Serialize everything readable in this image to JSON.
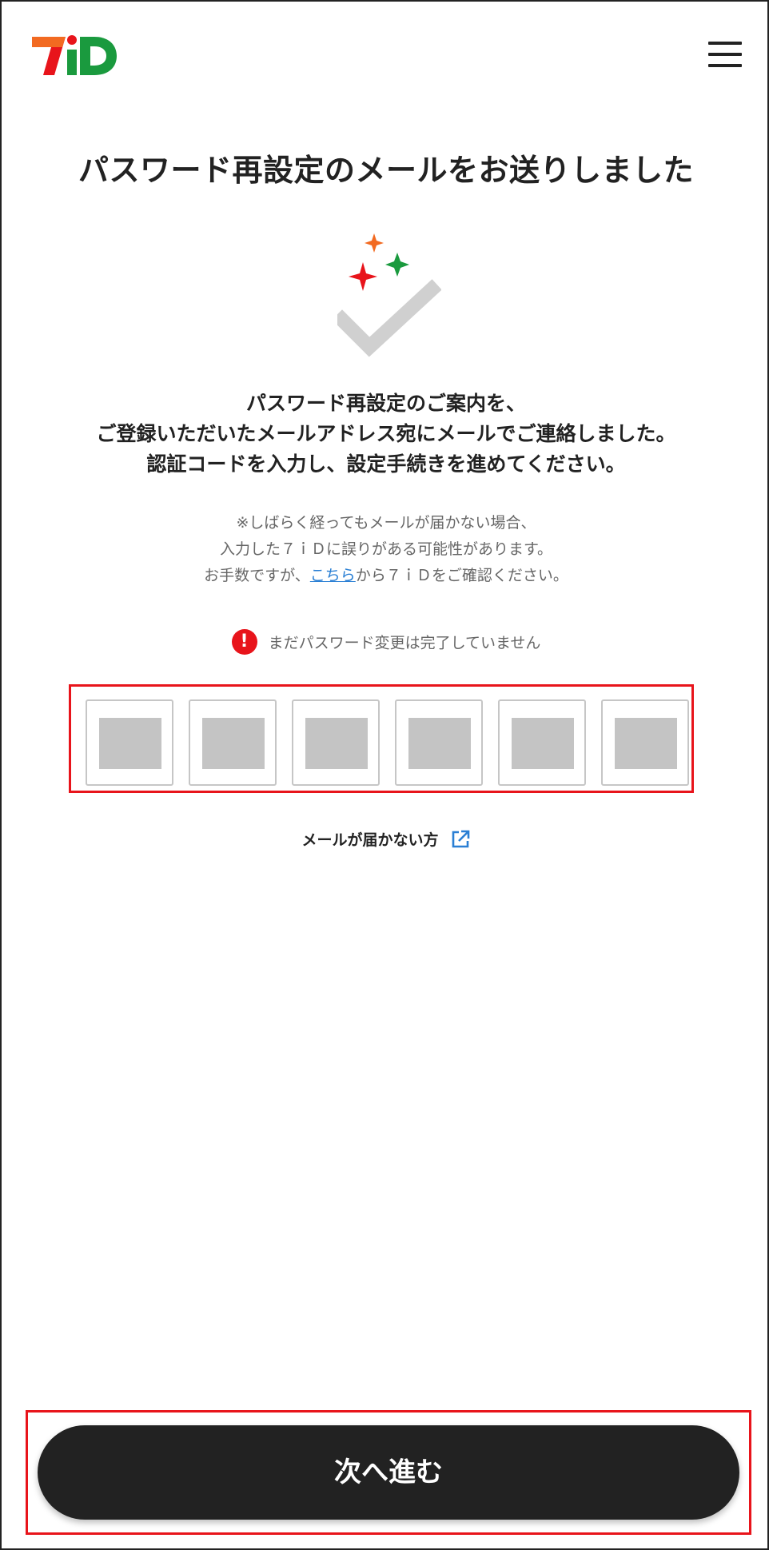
{
  "header": {
    "logo_text": "7iD",
    "menu_icon": "hamburger-menu-icon"
  },
  "main": {
    "title": "パスワード再設定のメールをお送りしました",
    "illustration_icon": "check-sparkle-icon",
    "message_lines": [
      "パスワード再設定のご案内を、",
      "ご登録いただいたメールアドレス宛にメールでご連絡しました。",
      "認証コードを入力し、設定手続きを進めてください。"
    ],
    "note": {
      "line1": "※しばらく経ってもメールが届かない場合、",
      "line2": "入力した７ｉＤに誤りがある可能性があります。",
      "line3_before": "お手数ですが、",
      "line3_link": "こちら",
      "line3_after": "から７ｉＤをご確認ください。"
    },
    "warning": {
      "icon": "exclamation-alert-icon",
      "text": "まだパスワード変更は完了していません"
    },
    "code_inputs_count": 6,
    "no_mail_link": {
      "label": "メールが届かない方",
      "icon": "external-link-icon"
    }
  },
  "footer": {
    "next_button_label": "次へ進む"
  },
  "colors": {
    "accent_red": "#e8141b",
    "logo_orange": "#f26a21",
    "logo_green": "#1a9a3e",
    "link_blue": "#2a7fd4",
    "button_dark": "#222222"
  }
}
